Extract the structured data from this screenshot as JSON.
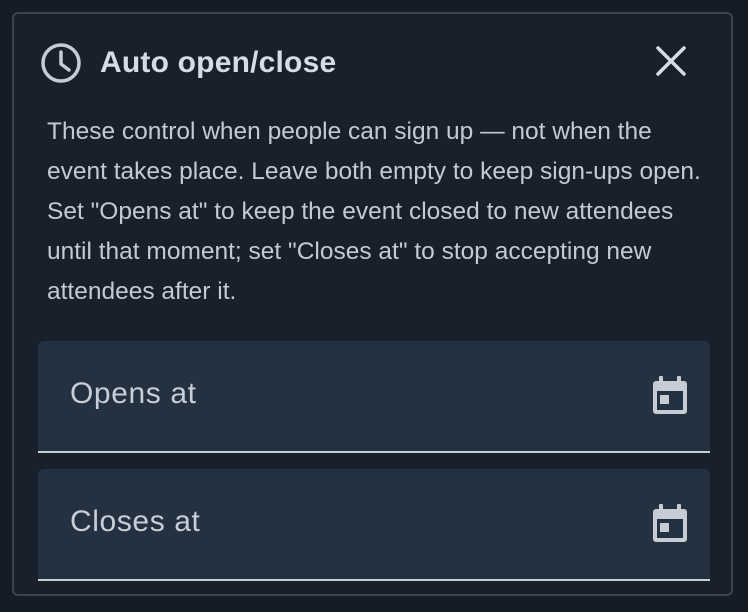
{
  "dialog": {
    "title": "Auto open/close",
    "header_icon": "clock-icon",
    "close_icon": "close-icon",
    "description": "These control when people can sign up — not when the event takes place. Leave both empty to keep sign-ups open. Set \"Opens at\" to keep the event closed to new attendees until that moment; set \"Closes at\" to stop accepting new attendees after it."
  },
  "fields": {
    "opens_at": {
      "label": "Opens at",
      "value": "",
      "icon": "calendar-icon"
    },
    "closes_at": {
      "label": "Closes at",
      "value": "",
      "icon": "calendar-icon"
    }
  },
  "colors": {
    "background": "#17202b",
    "field_background": "#233140",
    "text": "#d6dce4",
    "icon": "#c7ccd4"
  }
}
